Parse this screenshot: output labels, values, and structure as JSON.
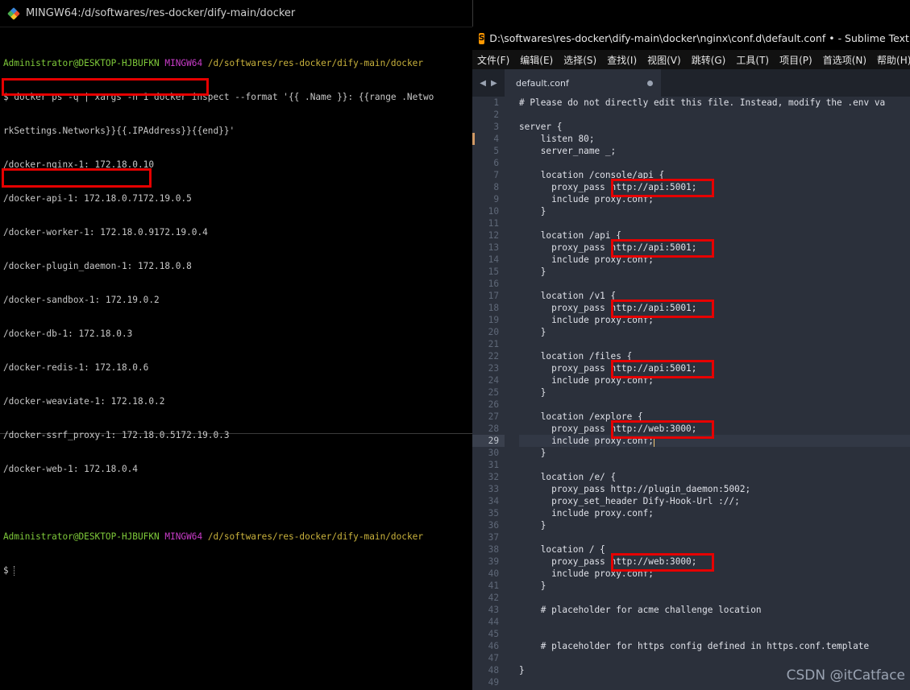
{
  "terminal": {
    "title": "MINGW64:/d/softwares/res-docker/dify-main/docker",
    "prompt": {
      "user": "Administrator@DESKTOP-HJBUFKN",
      "host": "MINGW64",
      "path": "/d/softwares/res-docker/dify-main/docker"
    },
    "command_line1": "$ docker ps -q | xargs -n 1 docker inspect --format '{{ .Name }}: {{range .Netwo",
    "command_line2": "rkSettings.Networks}}{{.IPAddress}}{{end}}'",
    "output": [
      "/docker-nginx-1: 172.18.0.10",
      "/docker-api-1: 172.18.0.7172.19.0.5",
      "/docker-worker-1: 172.18.0.9172.19.0.4",
      "/docker-plugin_daemon-1: 172.18.0.8",
      "/docker-sandbox-1: 172.19.0.2",
      "/docker-db-1: 172.18.0.3",
      "/docker-redis-1: 172.18.0.6",
      "/docker-weaviate-1: 172.18.0.2",
      "/docker-ssrf_proxy-1: 172.18.0.5172.19.0.3",
      "/docker-web-1: 172.18.0.4"
    ],
    "final_prompt": "$"
  },
  "sublime": {
    "title": "D:\\softwares\\res-docker\\dify-main\\docker\\nginx\\conf.d\\default.conf • - Sublime Text (AD",
    "logo": "S",
    "menu": [
      "文件(F)",
      "编辑(E)",
      "选择(S)",
      "查找(I)",
      "视图(V)",
      "跳转(G)",
      "工具(T)",
      "项目(P)",
      "首选项(N)",
      "帮助(H)"
    ],
    "tab": {
      "label": "default.conf"
    },
    "active_line": 29,
    "lines": [
      "# Please do not directly edit this file. Instead, modify the .env va",
      "",
      "server {",
      "    listen 80;",
      "    server_name _;",
      "",
      "    location /console/api {",
      "      proxy_pass http://api:5001;",
      "      include proxy.conf;",
      "    }",
      "",
      "    location /api {",
      "      proxy_pass http://api:5001;",
      "      include proxy.conf;",
      "    }",
      "",
      "    location /v1 {",
      "      proxy_pass http://api:5001;",
      "      include proxy.conf;",
      "    }",
      "",
      "    location /files {",
      "      proxy_pass http://api:5001;",
      "      include proxy.conf;",
      "    }",
      "",
      "    location /explore {",
      "      proxy_pass http://web:3000;",
      "      include proxy.conf;",
      "    }",
      "",
      "    location /e/ {",
      "      proxy_pass http://plugin_daemon:5002;",
      "      proxy_set_header Dify-Hook-Url ://;",
      "      include proxy.conf;",
      "    }",
      "",
      "    location / {",
      "      proxy_pass http://web:3000;",
      "      include proxy.conf;",
      "    }",
      "",
      "    # placeholder for acme challenge location",
      "",
      "",
      "    # placeholder for https config defined in https.conf.template",
      "",
      "}",
      ""
    ]
  },
  "watermark": "CSDN @itCatface",
  "colors": {
    "highlight": "#e60000",
    "editor_bg": "#2b303b",
    "terminal_bg": "#000000"
  }
}
